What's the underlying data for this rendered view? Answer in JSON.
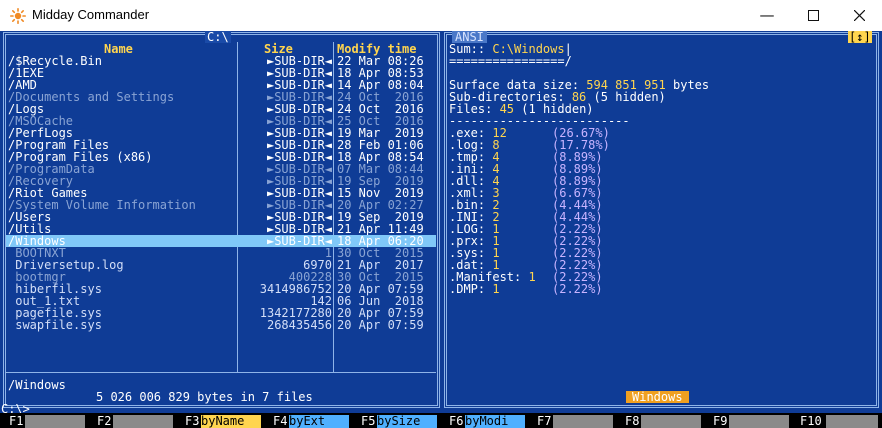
{
  "window": {
    "title": "Midday Commander"
  },
  "left": {
    "path_label": "C:\\",
    "headers": {
      "name": "Name",
      "size": "Size",
      "modify": "Modify time"
    },
    "rows": [
      {
        "name": "/$Recycle.Bin",
        "size": "►SUB-DIR◄",
        "date": "22 Mar 08:26",
        "kind": "dir"
      },
      {
        "name": "/1EXE",
        "size": "►SUB-DIR◄",
        "date": "18 Apr 08:53",
        "kind": "dir"
      },
      {
        "name": "/AMD",
        "size": "►SUB-DIR◄",
        "date": "14 Apr 08:04",
        "kind": "dir"
      },
      {
        "name": "/Documents and Settings",
        "size": "►SUB-DIR◄",
        "date": "24 Oct  2016",
        "kind": "hid"
      },
      {
        "name": "/Logs",
        "size": "►SUB-DIR◄",
        "date": "24 Oct  2016",
        "kind": "dir"
      },
      {
        "name": "/MSOCache",
        "size": "►SUB-DIR◄",
        "date": "25 Oct  2016",
        "kind": "hid"
      },
      {
        "name": "/PerfLogs",
        "size": "►SUB-DIR◄",
        "date": "19 Mar  2019",
        "kind": "dir"
      },
      {
        "name": "/Program Files",
        "size": "►SUB-DIR◄",
        "date": "28 Feb 01:06",
        "kind": "dir"
      },
      {
        "name": "/Program Files (x86)",
        "size": "►SUB-DIR◄",
        "date": "18 Apr 08:54",
        "kind": "dir"
      },
      {
        "name": "/ProgramData",
        "size": "►SUB-DIR◄",
        "date": "07 Mar 08:44",
        "kind": "hid"
      },
      {
        "name": "/Recovery",
        "size": "►SUB-DIR◄",
        "date": "19 Sep  2019",
        "kind": "hid"
      },
      {
        "name": "/Riot Games",
        "size": "►SUB-DIR◄",
        "date": "15 Nov  2019",
        "kind": "dir"
      },
      {
        "name": "/System Volume Information",
        "size": "►SUB-DIR◄",
        "date": "20 Apr 02:27",
        "kind": "hid"
      },
      {
        "name": "/Users",
        "size": "►SUB-DIR◄",
        "date": "19 Sep  2019",
        "kind": "dir"
      },
      {
        "name": "/Utils",
        "size": "►SUB-DIR◄",
        "date": "21 Apr 11:49",
        "kind": "dir"
      },
      {
        "name": "/Windows",
        "size": "►SUB-DIR◄",
        "date": "18 Apr 06:20",
        "kind": "sel"
      },
      {
        "name": " BOOTNXT",
        "size": "1",
        "date": "30 Oct  2015",
        "kind": "hid"
      },
      {
        "name": " Driversetup.log",
        "size": "6970",
        "date": "21 Apr  2017",
        "kind": "file"
      },
      {
        "name": " bootmgr",
        "size": "400228",
        "date": "30 Oct  2015",
        "kind": "hid"
      },
      {
        "name": " hiberfil.sys",
        "size": "3414986752",
        "date": "20 Apr 07:59",
        "kind": "file"
      },
      {
        "name": " out_1.txt",
        "size": "142",
        "date": "06 Jun  2018",
        "kind": "file"
      },
      {
        "name": " pagefile.sys",
        "size": "1342177280",
        "date": "20 Apr 07:59",
        "kind": "file"
      },
      {
        "name": " swapfile.sys",
        "size": "268435456",
        "date": "20 Apr 07:59",
        "kind": "file"
      }
    ],
    "selected_name": "/Windows",
    "summary": "5 026 006 829 bytes in 7 files"
  },
  "right": {
    "mode_label": "ANSI",
    "corner_label": "[↕]",
    "sum_prefix": "Sum:: ",
    "sum_path": "C:\\Windows",
    "sum_cursor": "|",
    "sum_underline": "================/",
    "surface_label": "Surface data size: ",
    "surface_value": "594 851 951",
    "surface_unit": " bytes",
    "subdirs_label": "Sub-directories: ",
    "subdirs_value": "86",
    "subdirs_hidden": "(5 hidden)",
    "files_label": "Files: ",
    "files_value": "45",
    "files_hidden": "(1 hidden)",
    "divider": "-------------------------",
    "exts": [
      {
        "ext": ".exe:",
        "count": "12",
        "pct": "(26.67%)"
      },
      {
        "ext": ".log:",
        "count": "8",
        "pct": "(17.78%)"
      },
      {
        "ext": ".tmp:",
        "count": "4",
        "pct": "(8.89%)"
      },
      {
        "ext": ".ini:",
        "count": "4",
        "pct": "(8.89%)"
      },
      {
        "ext": ".dll:",
        "count": "4",
        "pct": "(8.89%)"
      },
      {
        "ext": ".xml:",
        "count": "3",
        "pct": "(6.67%)"
      },
      {
        "ext": ".bin:",
        "count": "2",
        "pct": "(4.44%)"
      },
      {
        "ext": ".INI:",
        "count": "2",
        "pct": "(4.44%)"
      },
      {
        "ext": ".LOG:",
        "count": "1",
        "pct": "(2.22%)"
      },
      {
        "ext": ".prx:",
        "count": "1",
        "pct": "(2.22%)"
      },
      {
        "ext": ".sys:",
        "count": "1",
        "pct": "(2.22%)"
      },
      {
        "ext": ".dat:",
        "count": "1",
        "pct": "(2.22%)"
      },
      {
        "ext": ".Manifest:",
        "count": "1",
        "pct": "(2.22%)"
      },
      {
        "ext": ".DMP:",
        "count": "1",
        "pct": "(2.22%)"
      }
    ],
    "footer_label": "Windows"
  },
  "prompt": "C:\\>",
  "fkeys": [
    {
      "num": "F1",
      "label": ""
    },
    {
      "num": "F2",
      "label": ""
    },
    {
      "num": "F3",
      "label": "byName"
    },
    {
      "num": "F4",
      "label": "byExt"
    },
    {
      "num": "F5",
      "label": "bySize"
    },
    {
      "num": "F6",
      "label": "byModi"
    },
    {
      "num": "F7",
      "label": ""
    },
    {
      "num": "F8",
      "label": ""
    },
    {
      "num": "F9",
      "label": ""
    },
    {
      "num": "F10",
      "label": ""
    }
  ],
  "colors": {
    "console_bg": "#0f3c96",
    "selection_bg": "#80c8f8",
    "accent_yellow": "#ffd54f",
    "percent_violet": "#c8b4ff",
    "border": "#8fb4e8"
  }
}
